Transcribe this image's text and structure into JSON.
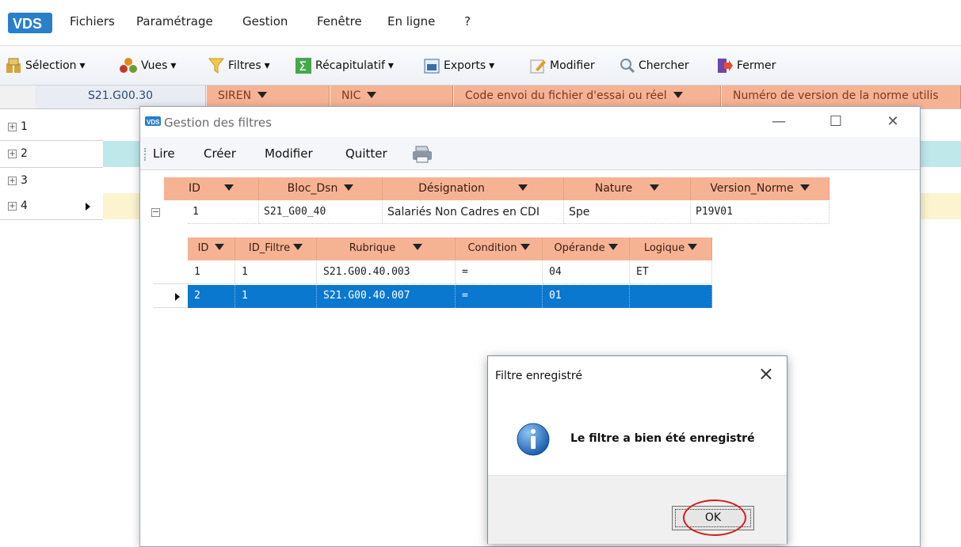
{
  "app": {
    "menu": [
      "Fichiers",
      "Paramétrage",
      "Gestion",
      "Fenêtre",
      "En ligne",
      "?"
    ],
    "toolbar": {
      "selection": "Sélection",
      "vues": "Vues",
      "filtres": "Filtres",
      "recapitulatif": "Récapitulatif",
      "exports": "Exports",
      "modifier": "Modifier",
      "chercher": "Chercher",
      "fermer": "Fermer"
    },
    "grid": {
      "columns": [
        "S21.G00.30",
        "SIREN",
        "NIC",
        "Code envoi du fichier d'essai ou réel",
        "Numéro de version de la norme utilis"
      ],
      "rows": [
        "1",
        "2",
        "3",
        "4"
      ],
      "row_colors": [
        "#ffffff",
        "#bfe8ea",
        "#ffffff",
        "#fbf4cf"
      ]
    }
  },
  "filter_window": {
    "title": "Gestion des filtres",
    "menu": {
      "lire": "Lire",
      "creer": "Créer",
      "modifier": "Modifier",
      "quitter": "Quitter"
    },
    "master": {
      "columns": [
        "ID",
        "Bloc_Dsn",
        "Désignation",
        "Nature",
        "Version_Norme"
      ],
      "row": [
        "1",
        "S21_G00_40",
        "Salariés Non Cadres en CDI",
        "Spe",
        "P19V01"
      ]
    },
    "detail": {
      "columns": [
        "ID",
        "ID_Filtre",
        "Rubrique",
        "Condition",
        "Opérande",
        "Logique"
      ],
      "rows": [
        [
          "1",
          "1",
          "S21.G00.40.003",
          "=",
          "04",
          "ET"
        ],
        [
          "2",
          "1",
          "S21.G00.40.007",
          "=",
          "01",
          ""
        ]
      ]
    }
  },
  "dialog": {
    "title": "Filtre enregistré",
    "message": "Le filtre a bien été enregistré",
    "ok": "OK"
  },
  "colors": {
    "header_orange": "#f6b394",
    "selection_blue": "#0b78d0",
    "highlight_red": "#d21e1e"
  }
}
